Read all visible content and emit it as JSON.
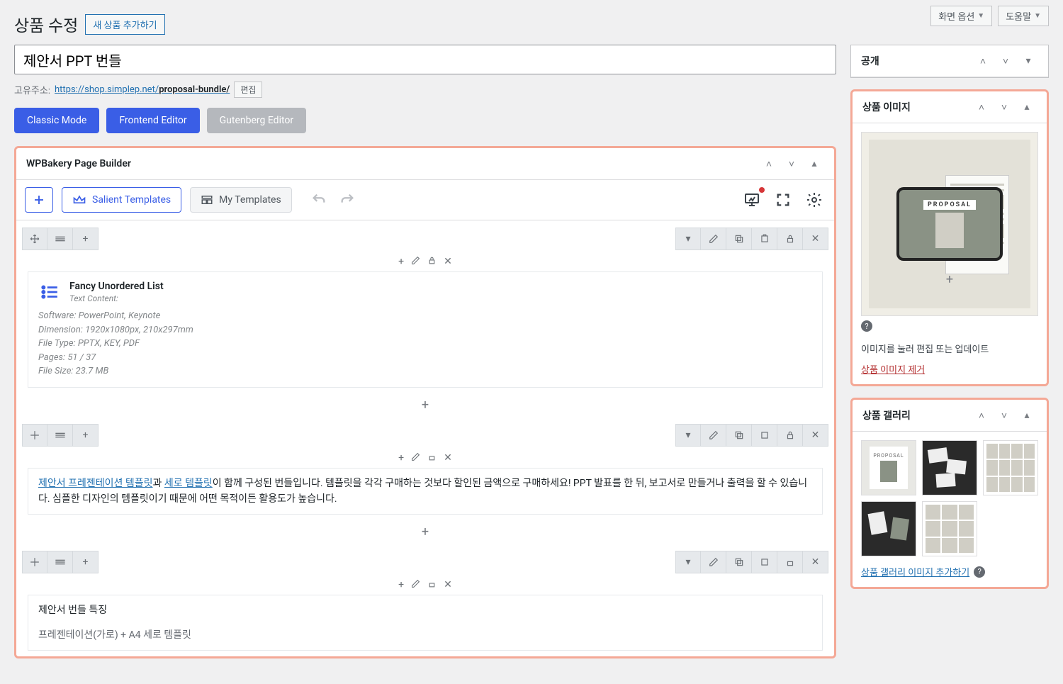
{
  "top": {
    "screen_options": "화면 옵션",
    "help": "도움말"
  },
  "header": {
    "page_title": "상품 수정",
    "add_new": "새 상품 추가하기"
  },
  "title_value": "제안서 PPT 번들",
  "permalink": {
    "label": "고유주소:",
    "base": "https://shop.simplep.net/",
    "slug": "proposal-bundle/",
    "edit": "편집"
  },
  "modes": {
    "classic": "Classic Mode",
    "frontend": "Frontend Editor",
    "gutenberg": "Gutenberg Editor"
  },
  "wpb": {
    "panel_title": "WPBakery Page Builder",
    "salient": "Salient Templates",
    "my_templates": "My Templates"
  },
  "rows": [
    {
      "type": "fancy_list",
      "title": "Fancy Unordered List",
      "subtitle": "Text Content:",
      "lines": [
        "Software: PowerPoint, Keynote",
        "Dimension: 1920x1080px, 210x297mm",
        "File Type: PPTX, KEY, PDF",
        "Pages: 51 / 37",
        "File Size: 23.7 MB"
      ]
    },
    {
      "type": "text",
      "link1": "제안서 프레젠테이션 템플릿",
      "conj1": "과 ",
      "link2": "세로 템플릿",
      "rest": "이 함께 구성된 번들입니다. 템플릿을 각각 구매하는 것보다 할인된 금액으로 구매하세요! PPT 발표를 한 뒤, 보고서로 만들거나 출력을 할 수 있습니다. 심플한 디자인의 템플릿이기 때문에 어떤 목적이든 활용도가 높습니다."
    },
    {
      "type": "text2",
      "heading": "제안서 번들 특징",
      "line": "프레젠테이션(가로) + A4 세로 템플릿"
    }
  ],
  "publish": {
    "title": "공개"
  },
  "product_image": {
    "title": "상품 이미지",
    "proposal_label": "PROPOSAL",
    "note": "이미지를 눌러 편집 또는 업데이트",
    "remove": "상품 이미지 제거"
  },
  "gallery": {
    "title": "상품 갤러리",
    "add": "상품 갤러리 이미지 추가하기",
    "thumbs": [
      "PROPOSAL",
      "",
      "",
      "",
      ""
    ]
  }
}
